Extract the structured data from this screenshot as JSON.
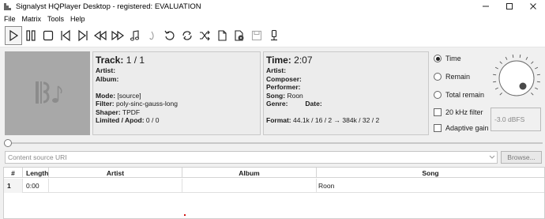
{
  "window": {
    "title": "Signalyst HQPlayer Desktop - registered: EVALUATION"
  },
  "menu": [
    "File",
    "Matrix",
    "Tools",
    "Help"
  ],
  "toolbar": {
    "buttons": [
      "play-icon",
      "pause-icon",
      "stop-icon",
      "previous-icon",
      "next-icon",
      "rewind-icon",
      "fast-forward-icon",
      "music-note-icon",
      "swirl-icon",
      "undo-icon",
      "repeat-icon",
      "shuffle-icon",
      "document-icon",
      "disc-icon",
      "save-icon",
      "microphone-icon"
    ]
  },
  "track_panel": {
    "heading_label": "Track:",
    "heading_value": "1 / 1",
    "artist_label": "Artist:",
    "album_label": "Album:",
    "mode_label": "Mode:",
    "mode_value": "[source]",
    "filter_label": "Filter:",
    "filter_value": "poly-sinc-gauss-long",
    "shaper_label": "Shaper:",
    "shaper_value": "TPDF",
    "limited_label": "Limited / Apod:",
    "limited_value": "0 / 0"
  },
  "time_panel": {
    "heading_label": "Time:",
    "heading_value": "2:07",
    "artist_label": "Artist:",
    "composer_label": "Composer:",
    "performer_label": "Performer:",
    "song_label": "Song:",
    "song_value": "Roon",
    "genre_label": "Genre:",
    "date_label": "Date:",
    "format_label": "Format:",
    "format_value": "44.1k / 16 / 2 → 384k / 32 / 2"
  },
  "display_mode": {
    "options": [
      "Time",
      "Remain",
      "Total remain"
    ],
    "selected": "Time"
  },
  "checks": {
    "filter_20khz": "20 kHz filter",
    "adaptive_gain": "Adaptive gain"
  },
  "volume": {
    "value": "-3.0 dBFS"
  },
  "uri": {
    "placeholder": "Content source URI"
  },
  "browse_label": "Browse...",
  "playlist": {
    "columns": [
      "#",
      "Length",
      "Artist",
      "Album",
      "Song"
    ],
    "rows": [
      {
        "num": "1",
        "length": "0:00",
        "artist": "",
        "album": "",
        "song": "Roon"
      }
    ]
  }
}
